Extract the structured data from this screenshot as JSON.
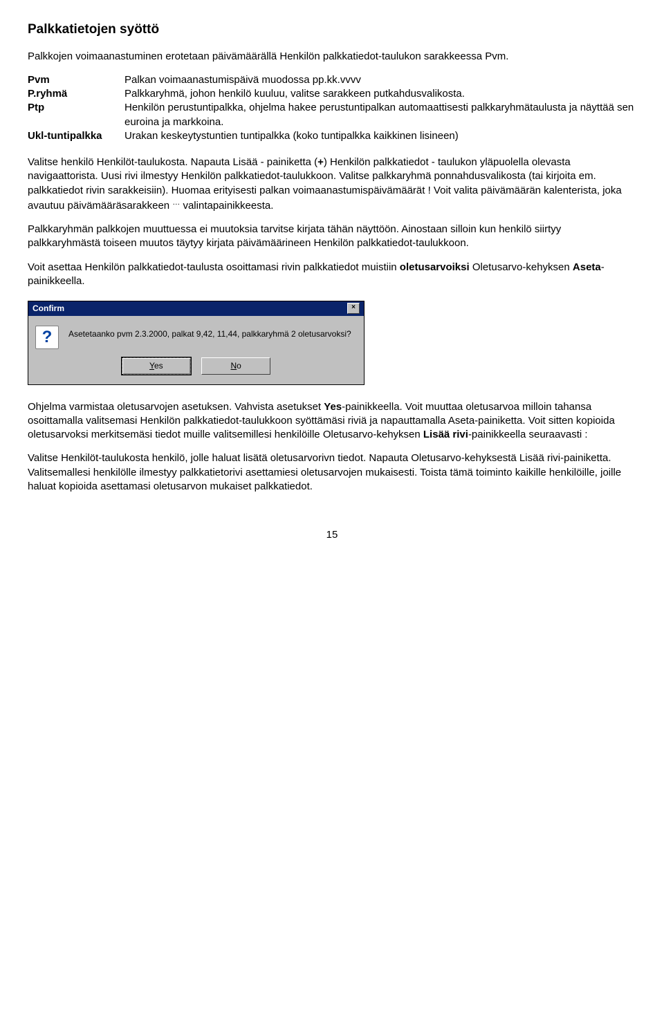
{
  "heading": "Palkkatietojen syöttö",
  "intro": "Palkkojen voimaanastuminen erotetaan päivämäärällä Henkilön palkkatiedot-taulukon sarakkeessa Pvm.",
  "defs": {
    "pvm": {
      "term": "Pvm",
      "text": "Palkan voimaanastumispäivä muodossa pp.kk.vvvv"
    },
    "pryhma": {
      "term": "P.ryhmä",
      "text": "Palkkaryhmä, johon henkilö kuuluu, valitse sarakkeen putkahdusvalikosta."
    },
    "ptp": {
      "term": "Ptp",
      "text": "Henkilön perustuntipalkka, ohjelma hakee perustuntipalkan automaattisesti palkkaryhmätaulusta ja näyttää sen euroina ja markkoina."
    },
    "ukl": {
      "term": "Ukl-tuntipalkka",
      "text": "Urakan keskeytystuntien tuntipalkka (koko tuntipalkka kaikkinen lisineen)"
    }
  },
  "para1_a": "Valitse henkilö Henkilöt-taulukosta. Napauta Lisää - painiketta (",
  "para1_plus": "+",
  "para1_b": ") Henkilön palkkatiedot - taulukon yläpuolella olevasta navigaattorista. Uusi rivi ilmestyy Henkilön palkkatiedot-taulukkoon. Valitse palkkaryhmä ponnahdusvalikosta (tai kirjoita em. palkkatiedot rivin sarakkeisiin). Huomaa erityisesti palkan voimaanastumispäivämäärät ! Voit valita päivämäärän kalenterista, joka avautuu päivämääräsarakkeen ",
  "para1_ellipsis": "…",
  "para1_c": " valintapainikkeesta.",
  "para2": "Palkkaryhmän palkkojen muuttuessa ei muutoksia tarvitse kirjata tähän näyttöön. Ainostaan silloin kun henkilö siirtyy palkkaryhmästä toiseen muutos täytyy kirjata päivämäärineen Henkilön palkkatiedot-taulukkoon.",
  "para3_a": "Voit asettaa Henkilön palkkatiedot-taulusta osoittamasi rivin palkkatiedot muistiin ",
  "para3_b": "oletusarvoiksi",
  "para3_c": " Oletusarvo-kehyksen ",
  "para3_d": "Aseta",
  "para3_e": "-painikkeella.",
  "dialog": {
    "title": "Confirm",
    "text": "Asetetaanko pvm 2.3.2000, palkat 9,42,  11,44, palkkaryhmä 2 oletusarvoksi?",
    "yes_u": "Y",
    "yes_rest": "es",
    "no_u": "N",
    "no_rest": "o"
  },
  "para4_a": "Ohjelma varmistaa oletusarvojen asetuksen. Vahvista asetukset ",
  "para4_b": "Yes",
  "para4_c": "-painikkeella. Voit muuttaa oletusarvoa milloin tahansa osoittamalla valitsemasi Henkilön palkkatiedot-taulukkoon syöttämäsi riviä ja napauttamalla Aseta-painiketta. Voit sitten kopioida oletusarvoksi merkitsemäsi tiedot muille valitsemillesi henkilöille Oletusarvo-kehyksen ",
  "para4_d": "Lisää rivi",
  "para4_e": "-painikkeella seuraavasti :",
  "para5_a": "Valitse Henkilöt-taulukosta henkilö, jolle haluat lisätä oletusarvorivn tiedot. Napauta Oletusarvo-kehyksestä Lisää rivi-painiketta. Valitsemallesi henkilölle ilmestyy palkkatietorivi asettamiesi oletusarvojen mukaisesti. Toista tämä toiminto kaikille henkilöille, joille haluat kopioida asettamasi oletusarvon mukaiset palkkatiedot.",
  "page_number": "15"
}
